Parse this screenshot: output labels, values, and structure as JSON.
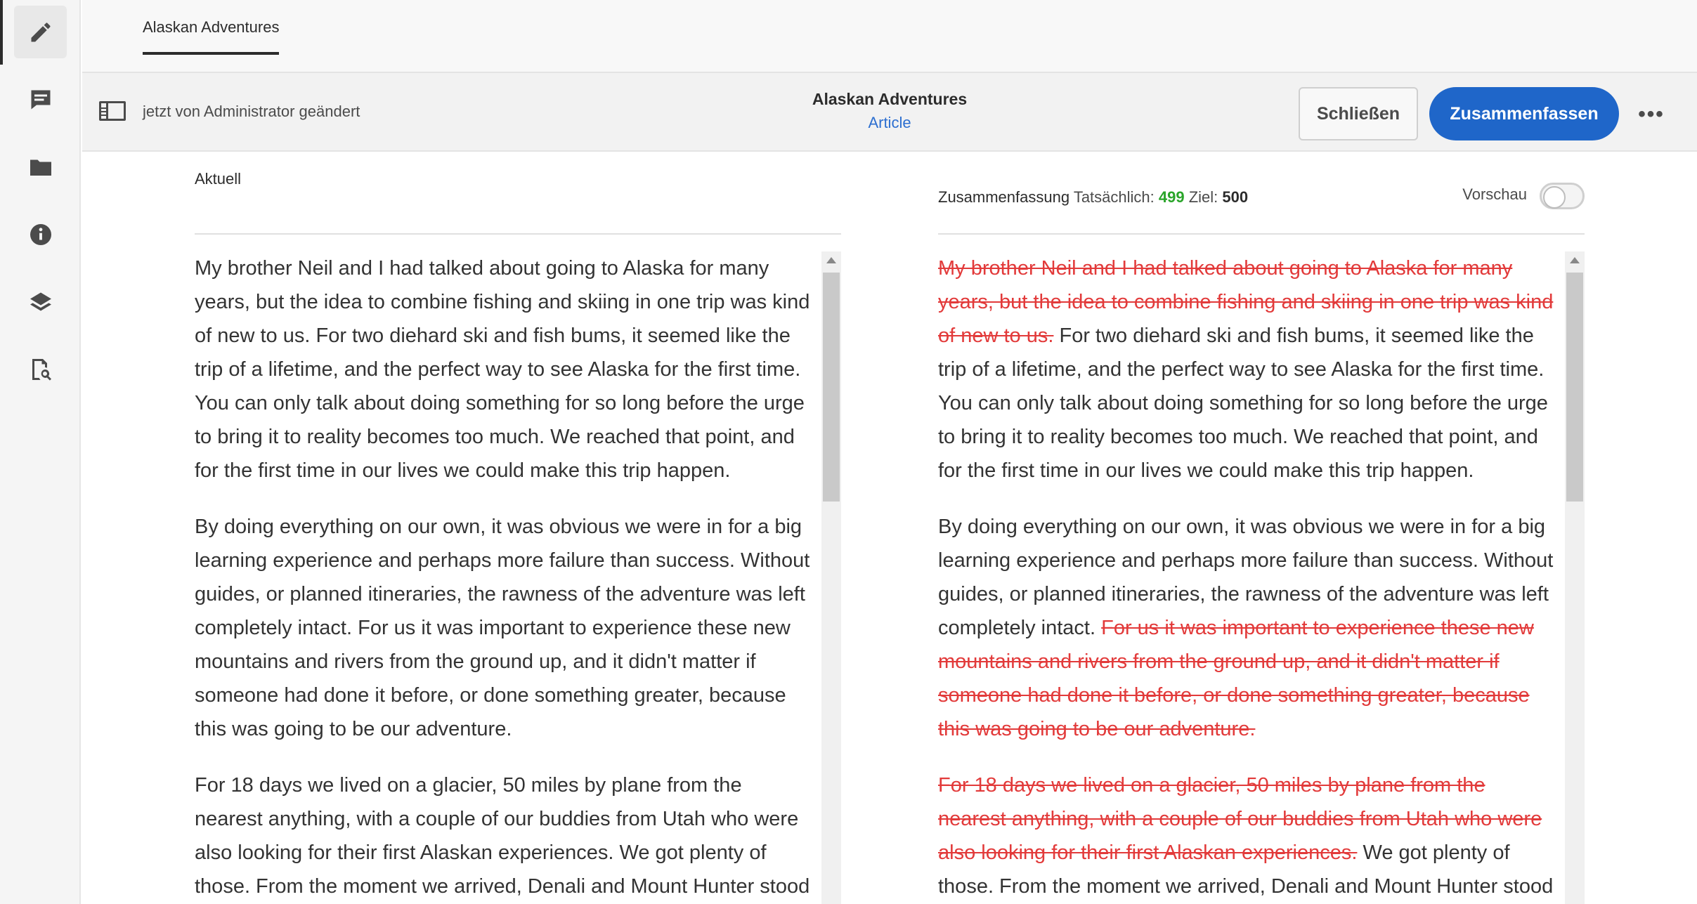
{
  "rail": {
    "items": [
      {
        "name": "edit",
        "icon": "pencil-icon"
      },
      {
        "name": "comments",
        "icon": "comment-icon"
      },
      {
        "name": "folder",
        "icon": "folder-icon"
      },
      {
        "name": "info",
        "icon": "info-icon"
      },
      {
        "name": "layers",
        "icon": "layers-icon"
      },
      {
        "name": "search-doc",
        "icon": "document-search-icon"
      }
    ]
  },
  "tabs": [
    {
      "label": "Alaskan Adventures"
    }
  ],
  "actionbar": {
    "status": "jetzt von Administrator geändert",
    "title": "Alaskan Adventures",
    "subtitle": "Article",
    "close_label": "Schließen",
    "summarize_label": "Zusammenfassen",
    "more_label": "•••"
  },
  "left": {
    "label": "Aktuell",
    "paragraphs": [
      "My brother Neil and I had talked about going to Alaska for many years, but the idea to combine fishing and skiing in one trip was kind of new to us. For two diehard ski and fish bums, it seemed like the trip of a lifetime, and the perfect way to see Alaska for the first time. You can only talk about doing something for so long before the urge to bring it to reality becomes too much. We reached that point, and for the first time in our lives we could make this trip happen.",
      "By doing everything on our own, it was obvious we were in for a big learning experience and perhaps more failure than success. Without guides, or planned itineraries, the rawness of the adventure was left completely intact. For us it was important to experience these new mountains and rivers from the ground up, and it didn't matter if someone had done it before, or done something greater, because this was going to be our adventure.",
      "For 18 days we lived on a glacier, 50 miles by plane from the nearest anything, with a couple of our buddies from Utah who were also looking for their first Alaskan experiences. We got plenty of those. From the moment we arrived, Denali and Mount Hunter stood watch over us, giving us a constant reminder of where we were."
    ]
  },
  "right": {
    "label": "Zusammenfassung",
    "actual_label": "Tatsächlich:",
    "actual_value": "499",
    "target_label": "Ziel:",
    "target_value": "500",
    "preview_label": "Vorschau",
    "p1_deleted": "My brother Neil and I had talked about going to Alaska for many years, but the idea to combine fishing and skiing in one trip was kind of new to us.",
    "p1_kept": " For two diehard ski and fish bums, it seemed like the trip of a lifetime, and the perfect way to see Alaska for the first time. You can only talk about doing something for so long before the urge to bring it to reality becomes too much. We reached that point, and for the first time in our lives we could make this trip happen.",
    "p2_kept": "By doing everything on our own, it was obvious we were in for a big learning experience and perhaps more failure than success. Without guides, or planned itineraries, the rawness of the adventure was left completely intact. ",
    "p2_deleted": "For us it was important to experience these new mountains and rivers from the ground up, and it didn't matter if someone had done it before, or done something greater, because this was going to be our adventure.",
    "p3_deleted": "For 18 days we lived on a glacier, 50 miles by plane from the nearest anything, with a couple of our buddies from Utah who were also looking for their first Alaskan experiences.",
    "p3_kept": " We got plenty of those. From the moment we arrived, Denali and Mount Hunter stood watch over us, giving us a constant reminder of where we were."
  },
  "colors": {
    "accent": "#1f66c9",
    "deleted": "#e23a3a",
    "actual_count": "#2aa52a"
  }
}
